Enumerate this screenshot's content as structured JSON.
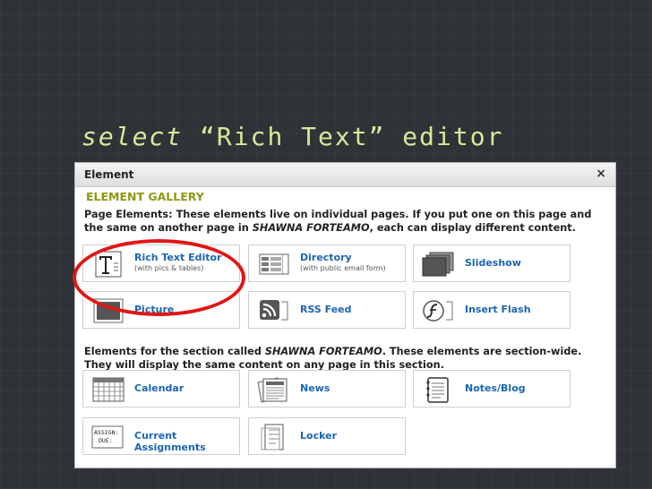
{
  "slide": {
    "title_italic": "select",
    "title_rest": " “Rich Text” editor"
  },
  "dialog": {
    "title": "Element",
    "close": "×",
    "gallery_title": "ELEMENT GALLERY",
    "page_section": {
      "d1": "Page Elements: These elements live on individual pages. If you put one on this page and the same on another page in ",
      "name": "SHAWNA FORTEAMO",
      "d2": ", each can display different content.",
      "items": [
        {
          "label": "Rich Text Editor",
          "sub": "(with pics & tables)",
          "icon": "rich-text-icon"
        },
        {
          "label": "Directory",
          "sub": "(with public email form)",
          "icon": "directory-icon"
        },
        {
          "label": "Slideshow",
          "sub": "",
          "icon": "slideshow-icon"
        },
        {
          "label": "Picture",
          "sub": "",
          "icon": "picture-icon"
        },
        {
          "label": "RSS Feed",
          "sub": "",
          "icon": "rss-icon"
        },
        {
          "label": "Insert Flash",
          "sub": "",
          "icon": "flash-icon"
        }
      ]
    },
    "section_section": {
      "d1": "Elements for the section called ",
      "name": "SHAWNA FORTEAMO",
      "d2": ". These elements are section-wide. They will display the same content on any page in this section.",
      "items": [
        {
          "label": "Calendar",
          "icon": "calendar-icon"
        },
        {
          "label": "News",
          "icon": "news-icon"
        },
        {
          "label": "Notes/Blog",
          "icon": "notes-icon"
        },
        {
          "label": "Current Assignments",
          "icon": "assignment-icon",
          "icon_text_1": "ASSIGN:",
          "icon_text_2": "DUE:"
        },
        {
          "label": "Locker",
          "icon": "locker-icon"
        }
      ]
    }
  }
}
